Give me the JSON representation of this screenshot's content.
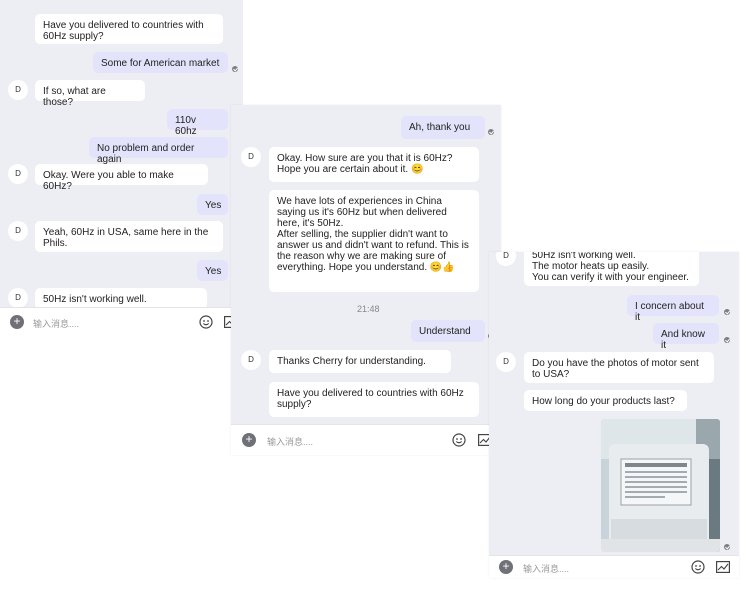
{
  "avatar_letter": "D",
  "input_placeholder": "输入消息....",
  "panel1": {
    "messages": [
      "Have you delivered to countries with 60Hz supply?",
      "Some for American market",
      "If so, what are those?",
      "110v 60hz",
      "No problem and order again",
      "Okay. Were you able to make 60Hz?",
      "Yes",
      "Yeah, 60Hz in USA, same here in the Phils.",
      "Yes",
      "50Hz isn't working well."
    ]
  },
  "panel2": {
    "messages": [
      "Ah, thank you",
      "Okay. How sure are you that it is 60Hz? Hope you are certain about it. 😊",
      "We have lots of experiences in China saying us it's 60Hz but when delivered here, it's 50Hz.\nAfter selling, the supplier didn't want to answer us and didn't want to refund. This is the reason why we are making sure of everything. Hope you understand. 😊👍",
      "Understand",
      "Thanks Cherry for understanding.",
      "Have you delivered to countries with 60Hz supply?"
    ],
    "timestamp": "21:48"
  },
  "panel3": {
    "messages": [
      "50Hz isn't working well.\nThe motor heats up easily.\nYou can verify it with your engineer.",
      "I concern about it",
      "And know it",
      "Do you have the photos of motor sent to USA?",
      "How long do your products last?"
    ]
  }
}
